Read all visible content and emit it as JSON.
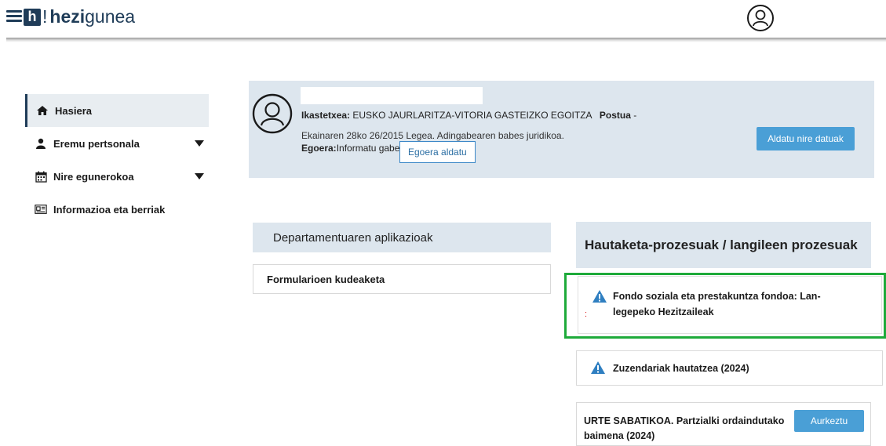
{
  "header": {
    "logo_bang": "!",
    "logo_bold": "hezi",
    "logo_light": "gunea",
    "logo_box_letter": "h",
    "menu_icon": "hamburger-icon",
    "user_icon": "user-avatar-icon"
  },
  "sidebar": {
    "items": [
      {
        "label": "Hasiera",
        "icon": "home-icon",
        "active": true
      },
      {
        "label": "Eremu pertsonala",
        "icon": "person-icon",
        "expandable": true
      },
      {
        "label": "Nire egunerokoa",
        "icon": "calendar-icon",
        "expandable": true
      },
      {
        "label": "Informazioa eta berriak",
        "icon": "news-icon"
      }
    ]
  },
  "profile": {
    "center_label": "Ikastetxea:",
    "center_value": "EUSKO JAURLARITZA-VITORIA GASTEIZKO EGOITZA",
    "post_label": "Postua",
    "post_value": "-",
    "law_text": "Ekainaren 28ko 26/2015 Legea. Adingabearen babes juridikoa.",
    "status_label": "Egoera:",
    "status_value": "Informatu gabe",
    "change_status_button": "Egoera aldatu",
    "edit_data_button": "Aldatu nire datuak"
  },
  "departments": {
    "heading": "Departamentuaren aplikazioak",
    "items": [
      {
        "label": "Formularioen kudeaketa"
      }
    ]
  },
  "processes": {
    "heading": "Hautaketa-prozesuak / langileen prozesuak",
    "items": [
      {
        "label": "Fondo soziala eta prestakuntza fondoa: Lan-legepeko Hezitzaileak",
        "icon": "warning-icon",
        "marker": ":"
      },
      {
        "label": "Zuzendariak hautatzea (2024)",
        "icon": "warning-icon"
      },
      {
        "label": "URTE SABATIKOA. Partzialki ordaindutako baimena (2024)",
        "button": "Aurkeztu"
      }
    ]
  },
  "colors": {
    "primary_dark": "#1f3c58",
    "panel_bg": "#dde6ee",
    "button_blue": "#4a9fd6",
    "highlight_green": "#1eaa3a",
    "warning_blue": "#2f7fc1"
  }
}
